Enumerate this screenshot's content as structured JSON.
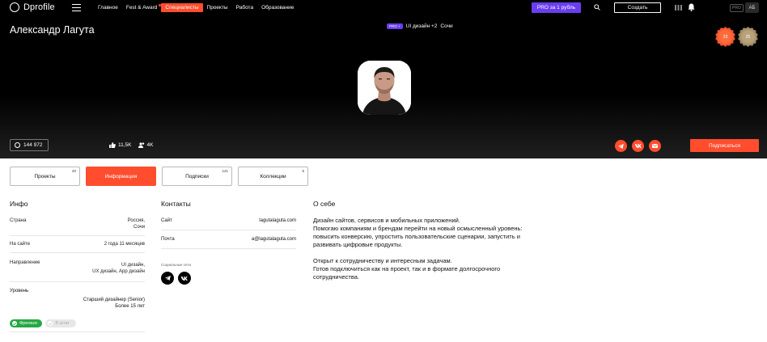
{
  "nav": {
    "logo": "Dprofile",
    "links": [
      {
        "label": "Главное"
      },
      {
        "label": "Fest & Award",
        "dot": true
      },
      {
        "label": "Специалисты",
        "active": true
      },
      {
        "label": "Проекты"
      },
      {
        "label": "Работа"
      },
      {
        "label": "Образование"
      }
    ],
    "pro_button": "PRO за 1 рубль",
    "create_button": "Создать",
    "pro_tag": "PRO",
    "avatar_initials": "АБ"
  },
  "profile": {
    "name": "Александр Лагута",
    "pro_badge": "PRO +",
    "specialty": "UI дизайн +2",
    "city": "Сочи",
    "awards": [
      "23",
      "25"
    ],
    "rating": "144 972",
    "likes": "11,5K",
    "followers": "4K",
    "subscribe_button": "Подписаться"
  },
  "tabs": [
    {
      "label": "Проекты",
      "count": "20"
    },
    {
      "label": "Информация",
      "active": true
    },
    {
      "label": "Подписки",
      "count": "121"
    },
    {
      "label": "Коллекции",
      "count": "5"
    }
  ],
  "info": {
    "title": "Инфо",
    "rows": [
      {
        "key": "Страна",
        "value": "Россия,\nСочи"
      },
      {
        "key": "На сайте",
        "value": "2 года 11 месяцев"
      },
      {
        "key": "Направление",
        "value": "UI дизайн,\nUX дизайн, App дизайн"
      },
      {
        "key": "Уровень",
        "value": "Старший дизайнер (Senior)\nБолее 15 лет"
      }
    ],
    "badge_freelance": "Фриланс",
    "badge_office": "В штат"
  },
  "contacts": {
    "title": "Контакты",
    "site_label": "Сайт",
    "site_value": "lagutalaguta.com",
    "mail_label": "Почта",
    "mail_value": "a@lagutalaguta.com",
    "social_label": "Социальные сети"
  },
  "about": {
    "title": "О себе",
    "p1": "Дизайн сайтов, сервисов и мобильных приложений.\nПомогаю компаниям и брендам перейти на новый осмысленный уровень: повысить конверсию, упростить пользовательские сценарии, запустить и развивать цифровые продукты.",
    "p2": "Открыт к сотрудничеству и интересным задачам.\nГотов подключиться как на проект, так и в формате долгосрочного сотрудничества."
  },
  "colors": {
    "accent": "#ff4d2e",
    "pro": "#6a3df0",
    "green": "#27a745"
  }
}
